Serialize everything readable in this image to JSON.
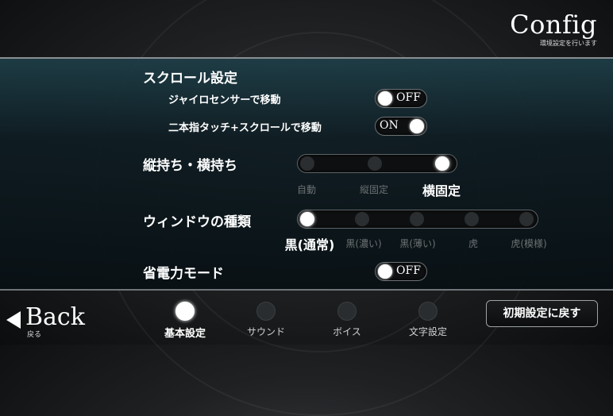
{
  "header": {
    "title": "Config",
    "subtitle": "環境設定を行います"
  },
  "scroll": {
    "heading": "スクロール設定",
    "gyro": {
      "label": "ジャイロセンサーで移動",
      "state": "OFF"
    },
    "two_finger": {
      "label": "二本指タッチ+スクロールで移動",
      "state": "ON"
    }
  },
  "orientation": {
    "heading": "縦持ち・横持ち",
    "options": [
      "自動",
      "縦固定",
      "横固定"
    ],
    "selected_index": 2
  },
  "window": {
    "heading": "ウィンドウの種類",
    "options": [
      "黒(通常)",
      "黒(濃い)",
      "黒(薄い)",
      "虎",
      "虎(模様)"
    ],
    "selected_index": 0
  },
  "power": {
    "heading": "省電力モード",
    "state": "OFF"
  },
  "footer": {
    "back_label": "Back",
    "back_sub": "戻る",
    "tabs": [
      "基本設定",
      "サウンド",
      "ボイス",
      "文字設定"
    ],
    "active_tab": 0,
    "reset_label": "初期設定に戻す"
  }
}
